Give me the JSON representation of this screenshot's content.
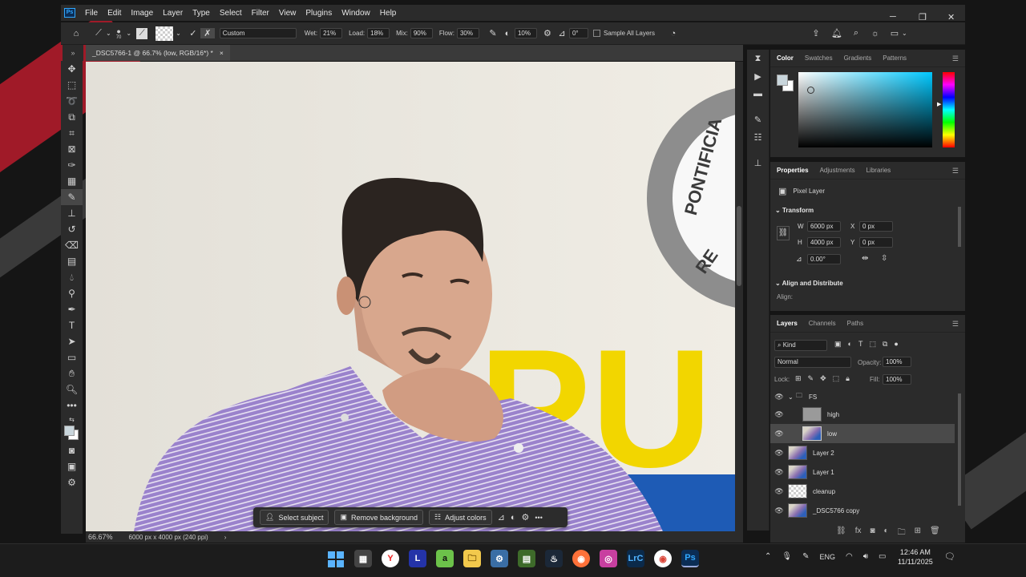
{
  "app": {
    "logo": "Ps",
    "doc_tab": "_DSC5766-1 @ 66.7% (low, RGB/16*) *",
    "tab_close": "×"
  },
  "menu": [
    "File",
    "Edit",
    "Image",
    "Layer",
    "Type",
    "Select",
    "Filter",
    "View",
    "Plugins",
    "Window",
    "Help"
  ],
  "options": {
    "brush_size": "70",
    "preset": "Custom",
    "wet_label": "Wet:",
    "wet": "21%",
    "load_label": "Load:",
    "load": "18%",
    "mix_label": "Mix:",
    "mix": "90%",
    "flow_label": "Flow:",
    "flow": "30%",
    "smoothing": "10%",
    "angle": "0°",
    "sample_all_layers": "Sample All Layers"
  },
  "canvas": {
    "sign_text": "PONTIFICIA",
    "sign_text_2": "RE",
    "big_letters": "PU"
  },
  "status": {
    "zoom": "66.67%",
    "doc_info": "6000 px x 4000 px (240 ppi)",
    "arrow": "›"
  },
  "context_bar": {
    "select_subject": "Select subject",
    "remove_background": "Remove background",
    "adjust_colors": "Adjust colors",
    "more": "•••"
  },
  "color_panel": {
    "tabs": [
      "Color",
      "Swatches",
      "Gradients",
      "Patterns"
    ],
    "fg": "#c9d6dc",
    "bg": "#ffffff"
  },
  "properties_panel": {
    "tabs": [
      "Properties",
      "Adjustments",
      "Libraries"
    ],
    "kind": "Pixel Layer",
    "transform": "Transform",
    "w_label": "W",
    "w": "6000 px",
    "h_label": "H",
    "h": "4000 px",
    "x_label": "X",
    "x": "0 px",
    "y_label": "Y",
    "y": "0 px",
    "angle": "0.00°",
    "align_distribute": "Align and Distribute",
    "align": "Align:"
  },
  "layers_panel": {
    "tabs": [
      "Layers",
      "Channels",
      "Paths"
    ],
    "kind": "Kind",
    "blend": "Normal",
    "opacity_label": "Opacity:",
    "opacity": "100%",
    "lock_label": "Lock:",
    "fill_label": "Fill:",
    "fill": "100%",
    "layers": [
      {
        "name": "FS",
        "type": "group"
      },
      {
        "name": "high",
        "type": "gray"
      },
      {
        "name": "low",
        "type": "photo",
        "selected": true
      },
      {
        "name": "Layer 2",
        "type": "photo"
      },
      {
        "name": "Layer 1",
        "type": "photo"
      },
      {
        "name": "cleanup",
        "type": "check"
      },
      {
        "name": "_DSC5766 copy",
        "type": "photo"
      }
    ]
  },
  "taskbar": {
    "apps": [
      "Windows",
      "Store",
      "Y",
      "L",
      "a",
      "Explorer",
      "Settings",
      "Game",
      "Steam",
      "Firefox",
      "Camera",
      "LrC",
      "Chrome",
      "Ps"
    ],
    "lang": "ENG",
    "time": "12:46 AM",
    "date": "11/11/2025"
  }
}
